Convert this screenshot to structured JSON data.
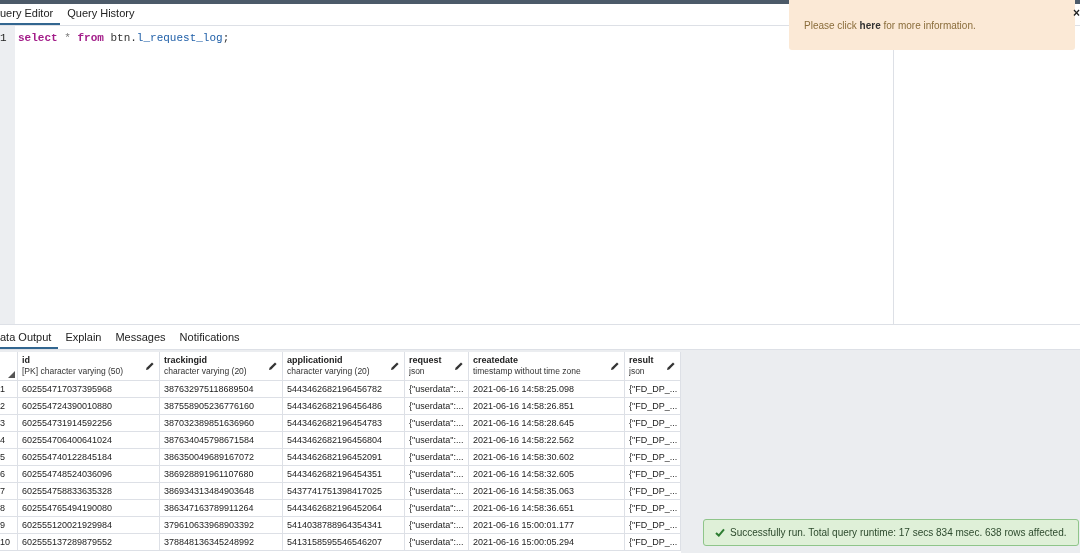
{
  "editor_tabs": [
    {
      "label": "uery Editor",
      "selected": true
    },
    {
      "label": "Query History",
      "selected": false
    }
  ],
  "editor": {
    "line_numbers": [
      "1"
    ],
    "tokens": [
      {
        "kind": "keyword",
        "text": "select"
      },
      {
        "kind": "operator",
        "text": "*"
      },
      {
        "kind": "keyword",
        "text": "from"
      },
      {
        "kind": "plain",
        "text": "btn."
      },
      {
        "kind": "table",
        "text": "l_request_log"
      },
      {
        "kind": "plain",
        "text": ";"
      }
    ]
  },
  "notice": {
    "message": "Please click **here** for more information.",
    "close": "×"
  },
  "output_tabs": [
    {
      "label": "ata Output",
      "selected": true
    },
    {
      "label": "Explain",
      "selected": false
    },
    {
      "label": "Messages",
      "selected": false
    },
    {
      "label": "Notifications",
      "selected": false
    }
  ],
  "table": {
    "columns": [
      {
        "name": "id",
        "type": "[PK] character varying (50)"
      },
      {
        "name": "trackingid",
        "type": "character varying (20)"
      },
      {
        "name": "applicationid",
        "type": "character varying (20)"
      },
      {
        "name": "request",
        "type": "json"
      },
      {
        "name": "createdate",
        "type": "timestamp without time zone"
      },
      {
        "name": "result",
        "type": "json"
      }
    ],
    "rows": [
      {
        "num": "1",
        "cells": [
          "602554717037395968",
          "387632975118689504",
          "5443462682196456782",
          "{\"userdata\":...",
          "2021-06-16 14:58:25.098",
          "{\"FD_DP_..."
        ]
      },
      {
        "num": "2",
        "cells": [
          "602554724390010880",
          "387558905236776160",
          "5443462682196456486",
          "{\"userdata\":...",
          "2021-06-16 14:58:26.851",
          "{\"FD_DP_..."
        ]
      },
      {
        "num": "3",
        "cells": [
          "602554731914592256",
          "387032389851636960",
          "5443462682196454783",
          "{\"userdata\":...",
          "2021-06-16 14:58:28.645",
          "{\"FD_DP_..."
        ]
      },
      {
        "num": "4",
        "cells": [
          "602554706400641024",
          "387634045798671584",
          "5443462682196456804",
          "{\"userdata\":...",
          "2021-06-16 14:58:22.562",
          "{\"FD_DP_..."
        ]
      },
      {
        "num": "5",
        "cells": [
          "602554740122845184",
          "386350049689167072",
          "5443462682196452091",
          "{\"userdata\":...",
          "2021-06-16 14:58:30.602",
          "{\"FD_DP_..."
        ]
      },
      {
        "num": "6",
        "cells": [
          "602554748524036096",
          "386928891961107680",
          "5443462682196454351",
          "{\"userdata\":...",
          "2021-06-16 14:58:32.605",
          "{\"FD_DP_..."
        ]
      },
      {
        "num": "7",
        "cells": [
          "602554758833635328",
          "386934313484903648",
          "5437741751398417025",
          "{\"userdata\":...",
          "2021-06-16 14:58:35.063",
          "{\"FD_DP_..."
        ]
      },
      {
        "num": "8",
        "cells": [
          "602554765494190080",
          "386347163789911264",
          "5443462682196452064",
          "{\"userdata\":...",
          "2021-06-16 14:58:36.651",
          "{\"FD_DP_..."
        ]
      },
      {
        "num": "9",
        "cells": [
          "602555120021929984",
          "379610633968903392",
          "5414038788964354341",
          "{\"userdata\":...",
          "2021-06-16 15:00:01.177",
          "{\"FD_DP_..."
        ]
      },
      {
        "num": "10",
        "cells": [
          "602555137289879552",
          "378848136345248992",
          "5413158595546546207",
          "{\"userdata\":...",
          "2021-06-16 15:00:05.294",
          "{\"FD_DP_..."
        ]
      }
    ]
  },
  "status": {
    "message": "Successfully run. Total query runtime: 17 secs 834 msec. 638 rows affected."
  }
}
